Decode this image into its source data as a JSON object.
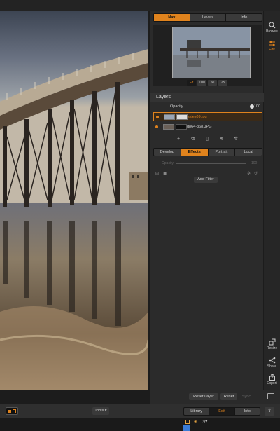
{
  "nav_tabs": [
    "Nav",
    "Levels",
    "Info"
  ],
  "zoom_options": [
    "Fit",
    "100",
    "50",
    "25"
  ],
  "layers": {
    "title": "Layers",
    "opacity_label": "Opacity",
    "opacity_value": "100",
    "items": [
      {
        "name": "skies09.jpg",
        "selected": true
      },
      {
        "name": "d864-368.JPG",
        "selected": false
      }
    ]
  },
  "edit_tabs": [
    "Develop",
    "Effects",
    "Portrait",
    "Local"
  ],
  "filter": {
    "opacity_label": "Opacity",
    "opacity_value": "100",
    "add_filter_label": "Add Filter"
  },
  "strip": {
    "browse": "Browse",
    "edit": "Edit",
    "resize": "Resize",
    "share": "Share",
    "export": "Export"
  },
  "actions": {
    "reset_layer": "Reset Layer",
    "reset": "Reset",
    "sync": "Sync"
  },
  "toolbar": {
    "tools_label": "Tools",
    "modes": [
      "Library",
      "Edit",
      "Info"
    ]
  },
  "colors": {
    "accent": "#e0831d",
    "panel": "#2b2b2b",
    "background": "#1c1c1c"
  }
}
